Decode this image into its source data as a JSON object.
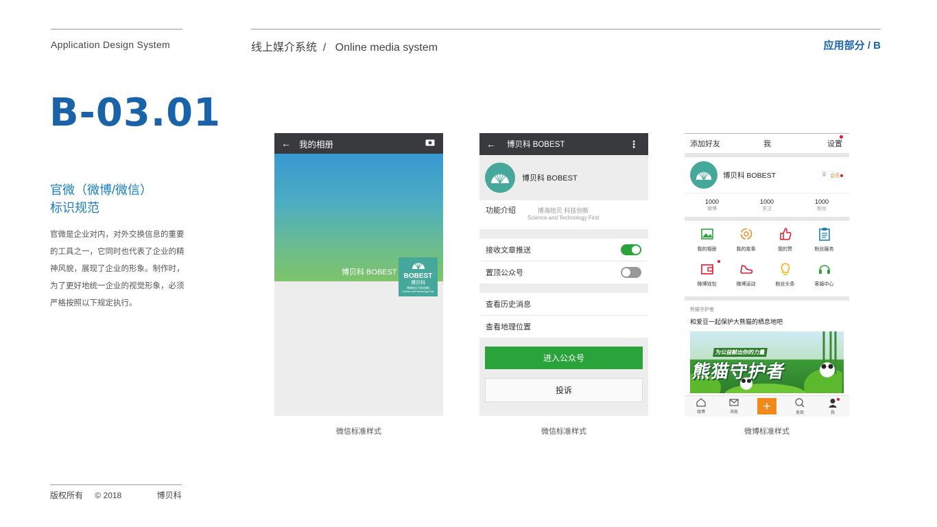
{
  "header": {
    "left_title": "Application Design System",
    "mid_title": "线上媒介系统  /   Online media system",
    "right_title": "应用部分 / B"
  },
  "page_code": "B-03.01",
  "section": {
    "title_line1": "官微（微博/微信）",
    "title_line2": "标识规范",
    "description": "官微是企业对内，对外交换信息的重要的工具之一，它同时也代表了企业的精神风貌，展现了企业的形象。制作时，为了更好地统一企业的视觉形象，必须严格按照以下规定执行。"
  },
  "footer": {
    "copyright": "版权所有",
    "year": "© 2018",
    "company": "博贝科"
  },
  "captions": [
    "微信标准样式",
    "微信标准样式",
    "微博标准样式"
  ],
  "phone1": {
    "title": "我的相册",
    "cover_name": "博贝科 BOBEST",
    "logo_en": "BOBEST",
    "logo_cn": "博贝科",
    "logo_tag": "博海拾贝 科技创新",
    "logo_tag_en": "Science and Technology First"
  },
  "phone2": {
    "title": "博贝科 BOBEST",
    "account_name": "博贝科 BOBEST",
    "intro_label": "功能介绍",
    "intro_slogan": "博海拾贝  科技创新",
    "intro_slogan_en": "Science and Technology First",
    "toggle1_label": "接收文章推送",
    "toggle1_on": true,
    "toggle2_label": "置顶公众号",
    "toggle2_on": false,
    "history_label": "查看历史消息",
    "location_label": "查看地理位置",
    "enter_button": "进入公众号",
    "complain_button": "投诉"
  },
  "phone3": {
    "add_friend": "添加好友",
    "me": "我",
    "settings": "设置",
    "account_name": "博贝科 BOBEST",
    "member": "会员",
    "stats": [
      {
        "value": "1000",
        "label": "微博"
      },
      {
        "value": "1000",
        "label": "关注"
      },
      {
        "value": "1000",
        "label": "粉丝"
      }
    ],
    "grid": [
      {
        "label": "我的相册",
        "icon": "album-icon"
      },
      {
        "label": "我的故事",
        "icon": "story-icon"
      },
      {
        "label": "我的赞",
        "icon": "like-icon"
      },
      {
        "label": "粉丝服务",
        "icon": "clipboard-icon"
      },
      {
        "label": "微博钱包",
        "icon": "wallet-icon"
      },
      {
        "label": "微博运动",
        "icon": "shoe-icon"
      },
      {
        "label": "粉丝头条",
        "icon": "bulb-icon"
      },
      {
        "label": "客服中心",
        "icon": "headset-icon"
      }
    ],
    "feed_source": "熊猫守护者",
    "feed_text": "和爱豆一起保护大熊猫的栖息地吧",
    "banner_small": "为公益献出你的力量",
    "banner_big": "熊猫守护者",
    "nav": [
      {
        "label": "微博",
        "icon": "home-icon"
      },
      {
        "label": "消息",
        "icon": "message-icon"
      },
      {
        "label": "",
        "icon": "plus-icon"
      },
      {
        "label": "发现",
        "icon": "discover-icon"
      },
      {
        "label": "我",
        "icon": "profile-icon"
      }
    ]
  },
  "colors": {
    "brand_blue": "#1a63a8",
    "wechat_green": "#2aa33a",
    "weibo_orange": "#f08a1c"
  }
}
